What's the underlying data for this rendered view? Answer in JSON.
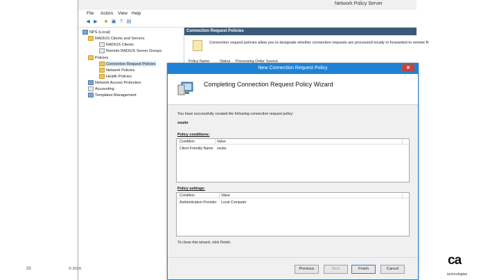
{
  "app": {
    "title": "Network Policy Server"
  },
  "menu": [
    "File",
    "Action",
    "View",
    "Help"
  ],
  "tree": {
    "items": [
      "NPS (Local)",
      "RADIUS Clients and Servers",
      "RADIUS Clients",
      "Remote RADIUS Server Groups",
      "Policies",
      "Connection Request Policies",
      "Network Policies",
      "Health Policies",
      "Network Access Protection",
      "Accounting",
      "Templates Management"
    ]
  },
  "right_pane": {
    "header": "Connection Request Policies",
    "description": "Connection request policies allow you to designate whether connection requests are processed locally or forwarded to remote R",
    "columns": [
      "Policy Name",
      "Status",
      "Processing Order",
      "Source"
    ]
  },
  "dialog": {
    "title": "New Connection Request Policy",
    "close_label": "✕",
    "heading": "Completing Connection Request Policy Wizard",
    "success_text": "You have successfully created the following connection request policy:",
    "policy_name": "xsuite",
    "conditions_label": "Policy conditions:",
    "conditions_columns": [
      "Condition",
      "Value"
    ],
    "conditions_row": [
      "Client Friendly Name",
      "xsuite"
    ],
    "settings_label": "Policy settings:",
    "settings_columns": [
      "Condition",
      "Value"
    ],
    "settings_row": [
      "Authentication Provider",
      "Local Computer"
    ],
    "close_text": "To close this wizard, click Finish.",
    "buttons": {
      "previous": "Previous",
      "next": "Next",
      "finish": "Finish",
      "cancel": "Cancel"
    }
  },
  "slide": {
    "number": "33",
    "footer": "© 2016"
  },
  "logo": {
    "mark": "ca",
    "text": "technologies"
  },
  "colors": {
    "dialog_accent": "#1d82d6",
    "pane_header": "#3c5a78",
    "close": "#c7443a"
  }
}
